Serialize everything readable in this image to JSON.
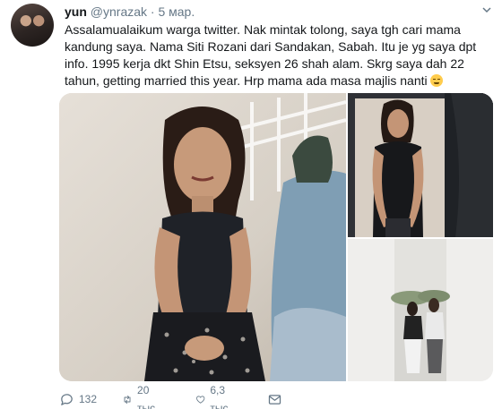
{
  "tweet": {
    "author_name": "yun",
    "author_handle": "@ynrazak",
    "separator": "·",
    "date": "5 мар.",
    "text": "Assalamualaikum warga twitter. Nak mintak tolong, saya tgh cari mama kandung saya. Nama Siti Rozani dari Sandakan, Sabah. Itu je yg saya dpt info. 1995 kerja dkt Shin Etsu, seksyen 26 shah alam. Skrg saya dah 22 tahun, getting married this year. Hrp mama ada masa majlis nanti",
    "emoji": "relieved-face-emoji"
  },
  "actions": {
    "replies": "132",
    "retweets": "20 тыс.",
    "likes": "6,3 тыс."
  },
  "icons": {
    "reply": "reply-icon",
    "retweet": "retweet-icon",
    "like": "heart-icon",
    "dm": "envelope-icon",
    "more": "chevron-down-icon"
  },
  "colors": {
    "text": "#14171a",
    "secondary": "#657786",
    "background": "#ffffff"
  }
}
